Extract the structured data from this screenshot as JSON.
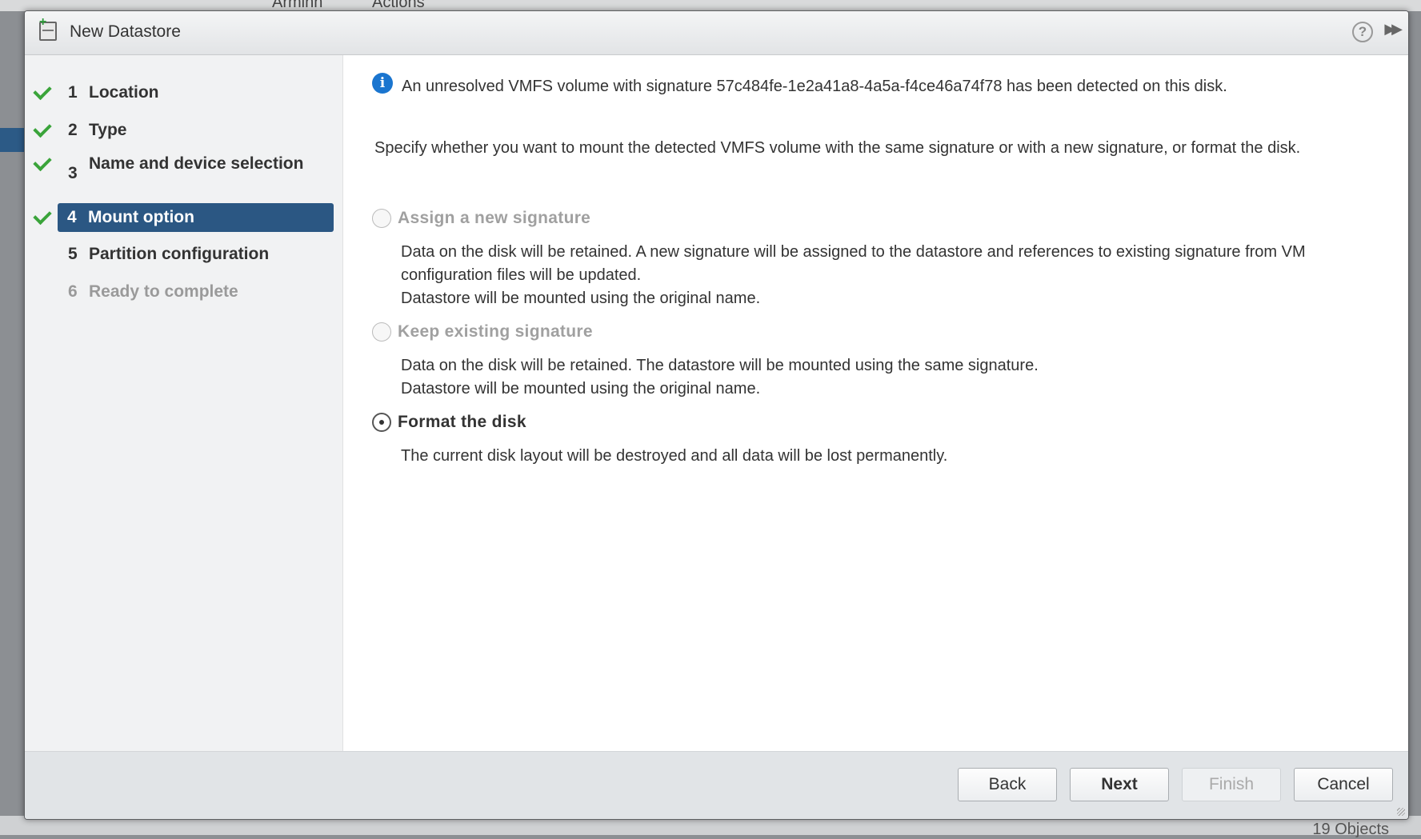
{
  "background": {
    "top_label_1": "Arminn",
    "top_label_2": "Actions",
    "objects_count": "19 Objects"
  },
  "dialog": {
    "title": "New Datastore",
    "help_symbol": "?"
  },
  "steps": [
    {
      "num": "1",
      "label": "Location",
      "state": "done"
    },
    {
      "num": "2",
      "label": "Type",
      "state": "done"
    },
    {
      "num": "3",
      "label": "Name and device selection",
      "state": "done"
    },
    {
      "num": "4",
      "label": "Mount option",
      "state": "active"
    },
    {
      "num": "5",
      "label": "Partition configuration",
      "state": "pending"
    },
    {
      "num": "6",
      "label": "Ready to complete",
      "state": "disabled"
    }
  ],
  "content": {
    "info_symbol": "i",
    "info_text": "An unresolved VMFS volume with signature 57c484fe-1e2a41a8-4a5a-f4ce46a74f78 has been detected on this disk.",
    "intro": "Specify whether you want to mount the detected VMFS volume with the same signature or with a new signature, or format the disk.",
    "options": [
      {
        "label": "Assign a new signature",
        "enabled": false,
        "selected": false,
        "desc_1": "Data on the disk will be retained. A new signature will be assigned to the datastore and references to existing signature from VM configuration files will be updated.",
        "desc_2": "Datastore will be mounted using the original name."
      },
      {
        "label": "Keep existing signature",
        "enabled": false,
        "selected": false,
        "desc_1": "Data on the disk will be retained. The datastore will be mounted using the same signature.",
        "desc_2": "Datastore will be mounted using the original name."
      },
      {
        "label": "Format the disk",
        "enabled": true,
        "selected": true,
        "desc_1": "The current disk layout will be destroyed and all data will be lost permanently."
      }
    ]
  },
  "footer": {
    "back": "Back",
    "next": "Next",
    "finish": "Finish",
    "cancel": "Cancel"
  },
  "colors": {
    "active_step_bg": "#2b5783",
    "check_green": "#3aa43a",
    "info_blue": "#1a75cf"
  }
}
